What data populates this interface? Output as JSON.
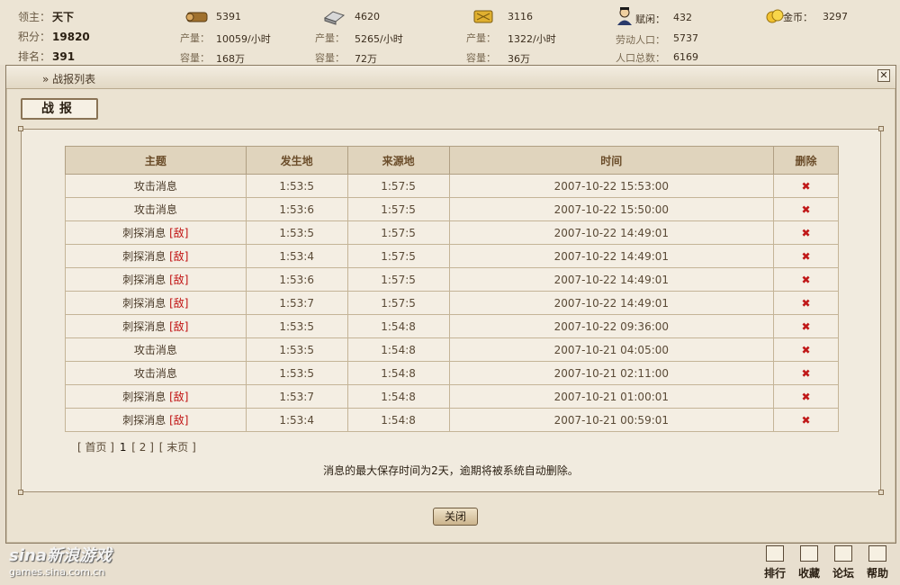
{
  "top": {
    "lord": {
      "label": "领主：",
      "value": "天下"
    },
    "score": {
      "label": "积分：",
      "value": "19820"
    },
    "rank": {
      "label": "排名：",
      "value": "391"
    },
    "wood": {
      "amount": "5391",
      "prod_label": "产量：",
      "prod": "10059/小时",
      "cap_label": "容量：",
      "cap": "168万"
    },
    "iron": {
      "amount": "4620",
      "prod_label": "产量：",
      "prod": "5265/小时",
      "cap_label": "容量：",
      "cap": "72万"
    },
    "grain": {
      "amount": "3116",
      "prod_label": "产量：",
      "prod": "1322/小时",
      "cap_label": "容量：",
      "cap": "36万"
    },
    "people": {
      "label": "赋闲：",
      "value": "432",
      "labor_label": "劳动人口：",
      "labor": "5737",
      "total_label": "人口总数：",
      "total": "6169"
    },
    "gold": {
      "label": "金币：",
      "value": "3297"
    }
  },
  "window": {
    "breadcrumb": "» 战报列表",
    "close_glyph": "✕",
    "heading": "战报",
    "columns": [
      "主题",
      "发生地",
      "来源地",
      "时间",
      "删除"
    ],
    "rows": [
      {
        "subject": "攻击消息",
        "enemy": "",
        "place": "1:53:5",
        "source": "1:57:5",
        "time": "2007-10-22 15:53:00"
      },
      {
        "subject": "攻击消息",
        "enemy": "",
        "place": "1:53:6",
        "source": "1:57:5",
        "time": "2007-10-22 15:50:00"
      },
      {
        "subject": "刺探消息",
        "enemy": "[敌]",
        "place": "1:53:5",
        "source": "1:57:5",
        "time": "2007-10-22 14:49:01"
      },
      {
        "subject": "刺探消息",
        "enemy": "[敌]",
        "place": "1:53:4",
        "source": "1:57:5",
        "time": "2007-10-22 14:49:01"
      },
      {
        "subject": "刺探消息",
        "enemy": "[敌]",
        "place": "1:53:6",
        "source": "1:57:5",
        "time": "2007-10-22 14:49:01"
      },
      {
        "subject": "刺探消息",
        "enemy": "[敌]",
        "place": "1:53:7",
        "source": "1:57:5",
        "time": "2007-10-22 14:49:01"
      },
      {
        "subject": "刺探消息",
        "enemy": "[敌]",
        "place": "1:53:5",
        "source": "1:54:8",
        "time": "2007-10-22 09:36:00"
      },
      {
        "subject": "攻击消息",
        "enemy": "",
        "place": "1:53:5",
        "source": "1:54:8",
        "time": "2007-10-21 04:05:00"
      },
      {
        "subject": "攻击消息",
        "enemy": "",
        "place": "1:53:5",
        "source": "1:54:8",
        "time": "2007-10-21 02:11:00"
      },
      {
        "subject": "刺探消息",
        "enemy": "[敌]",
        "place": "1:53:7",
        "source": "1:54:8",
        "time": "2007-10-21 01:00:01"
      },
      {
        "subject": "刺探消息",
        "enemy": "[敌]",
        "place": "1:53:4",
        "source": "1:54:8",
        "time": "2007-10-21 00:59:01"
      }
    ],
    "delete_glyph": "✖",
    "pager": {
      "first": "[ 首页 ]",
      "page1": "1",
      "page2": "[ 2 ]",
      "last": "[ 末页 ]"
    },
    "notice": "消息的最大保存时间为2天，逾期将被系统自动删除。",
    "close_button": "关闭"
  },
  "footer": {
    "brand": "sina新浪游戏",
    "url": "games.sina.com.cn",
    "nav": [
      "排行",
      "收藏",
      "论坛",
      "帮助"
    ]
  },
  "colors": {
    "enemy": "#c01010",
    "header": "#6b4d2a",
    "background": "#e8dfcf"
  }
}
